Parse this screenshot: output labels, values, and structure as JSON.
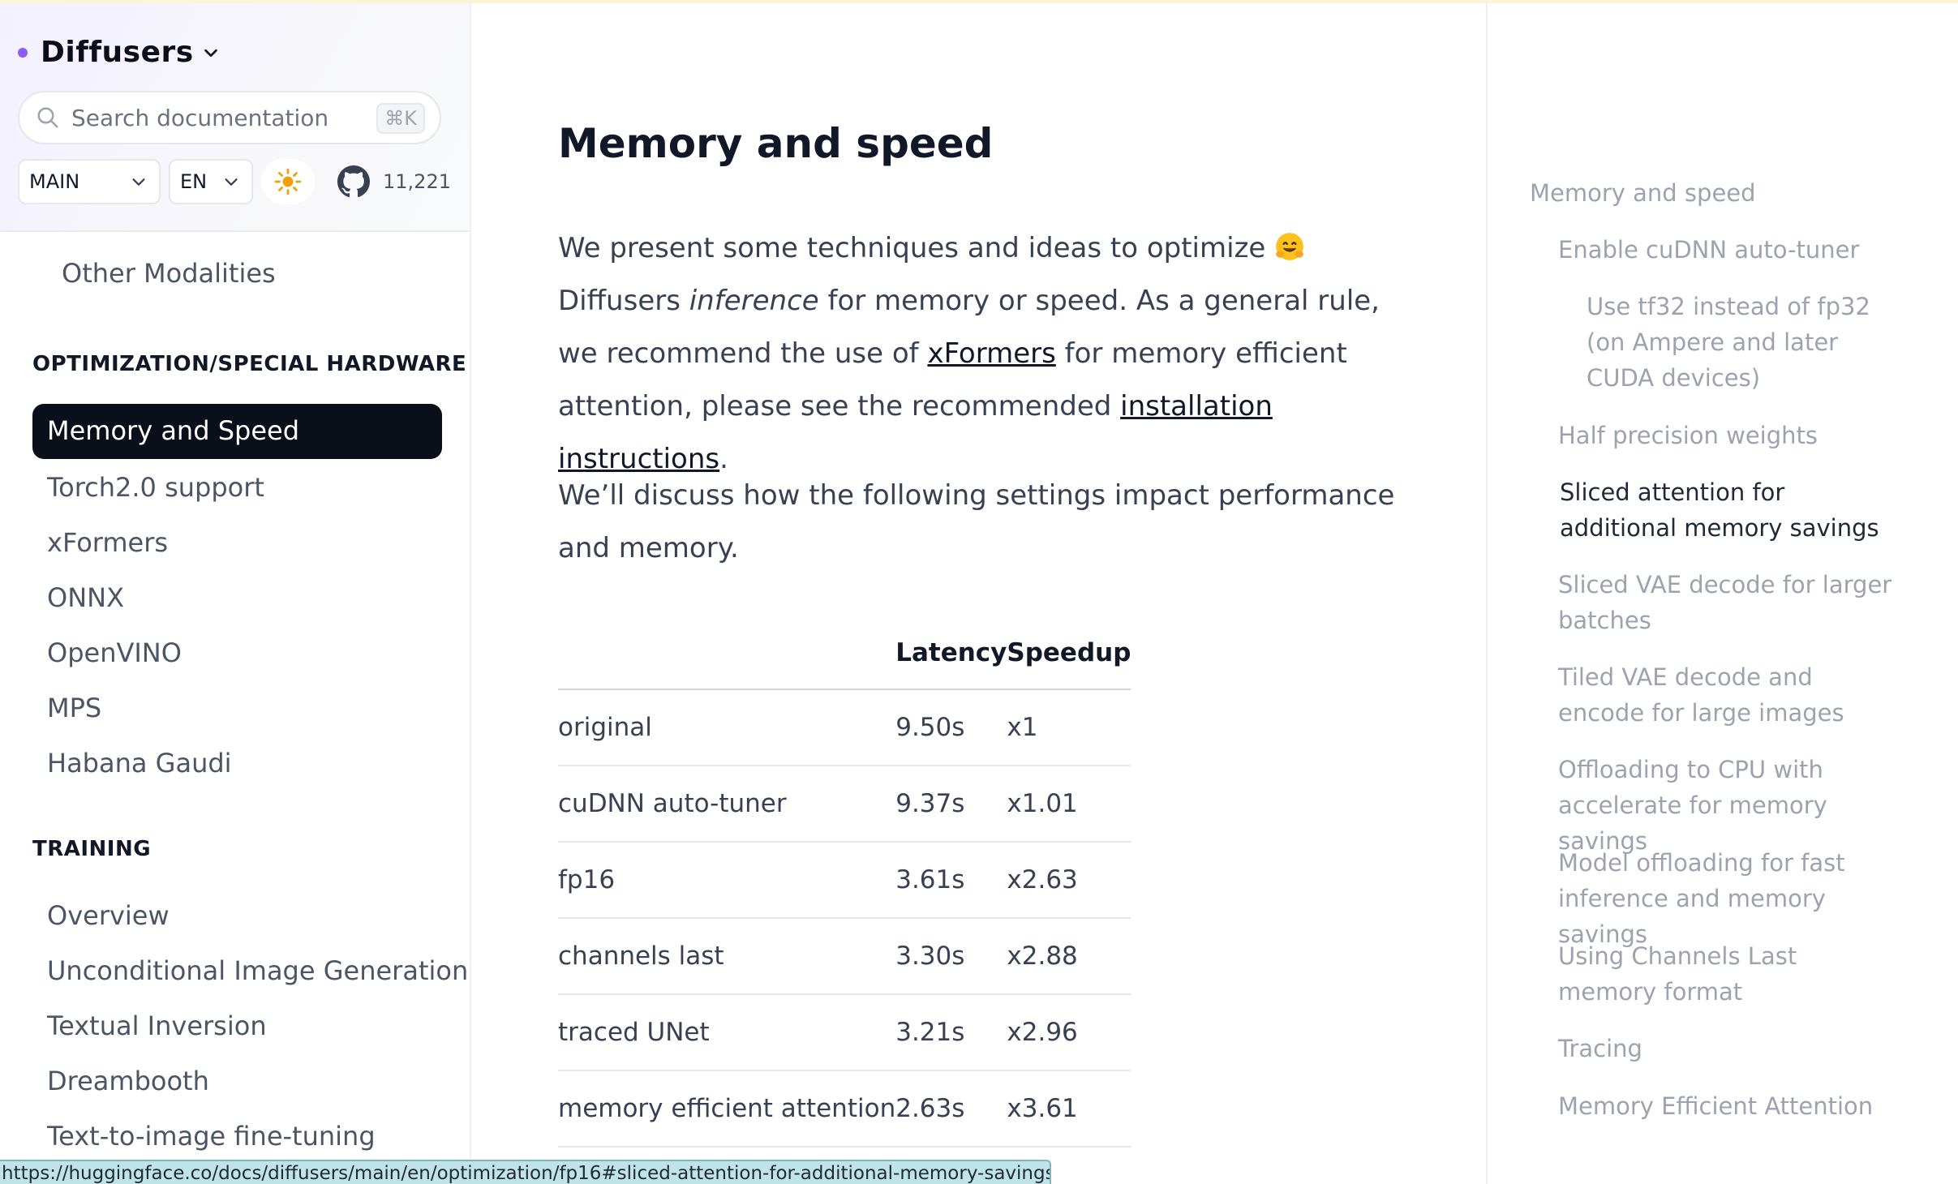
{
  "sidebar": {
    "brand": "Diffusers",
    "search": {
      "placeholder": "Search documentation",
      "shortcut": "⌘K"
    },
    "version": "MAIN",
    "language": "EN",
    "github_stars": "11,221",
    "nav": {
      "top_item": "Other Modalities",
      "section1": "OPTIMIZATION/SPECIAL HARDWARE",
      "active_item": "Memory and Speed",
      "items1": [
        "Torch2.0 support",
        "xFormers",
        "ONNX",
        "OpenVINO",
        "MPS",
        "Habana Gaudi"
      ],
      "section2": "TRAINING",
      "items2": [
        "Overview",
        "Unconditional Image Generation",
        "Textual Inversion",
        "Dreambooth",
        "Text-to-image fine-tuning"
      ]
    }
  },
  "main": {
    "title": "Memory and speed",
    "para1": {
      "t1": "We present some techniques and ideas to optimize ",
      "t2": " Diffusers ",
      "em": "inference",
      "t3": " for memory or speed. As a general rule, we recommend the use of ",
      "link1": "xFormers",
      "t4": " for memory efficient attention, please see the recommended ",
      "link2": "installation instructions",
      "t5": "."
    },
    "para2": "We’ll discuss how the following settings impact performance and memory.",
    "table": {
      "headers": [
        "",
        "Latency",
        "Speedup"
      ],
      "rows": [
        [
          "original",
          "9.50s",
          "x1"
        ],
        [
          "cuDNN auto-tuner",
          "9.37s",
          "x1.01"
        ],
        [
          "fp16",
          "3.61s",
          "x2.63"
        ],
        [
          "channels last",
          "3.30s",
          "x2.88"
        ],
        [
          "traced UNet",
          "3.21s",
          "x2.96"
        ],
        [
          "memory efficient attention",
          "2.63s",
          "x3.61"
        ]
      ]
    }
  },
  "toc": {
    "items": [
      "Memory and speed",
      "Enable cuDNN auto-tuner",
      "Use tf32 instead of fp32 (on Ampere and later CUDA devices)",
      "Half precision weights",
      "Sliced attention for additional memory savings",
      "Sliced VAE decode for larger batches",
      "Tiled VAE decode and encode for large images",
      "Offloading to CPU with accelerate for memory savings",
      "Model offloading for fast inference and memory savings",
      "Using Channels Last memory format",
      "Tracing",
      "Memory Efficient Attention"
    ]
  },
  "statusbar": {
    "url": "https://huggingface.co/docs/diffusers/main/en/optimization/fp16#sliced-attention-for-additional-memory-savings"
  }
}
